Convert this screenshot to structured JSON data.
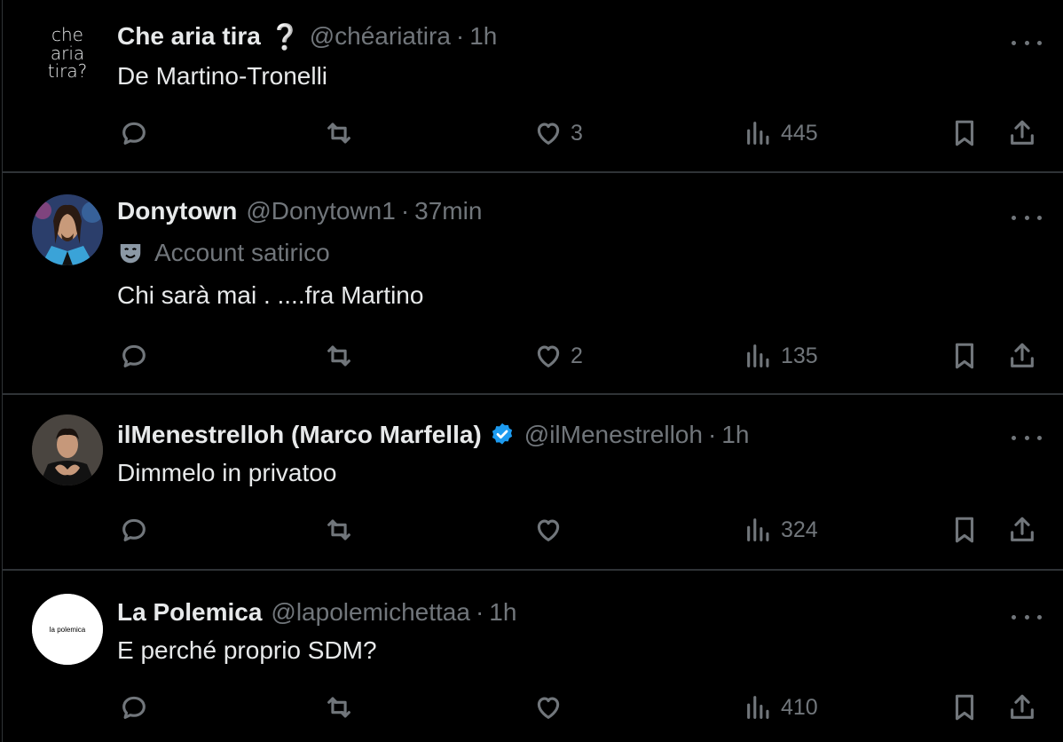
{
  "tweets": [
    {
      "name": "Che aria tira",
      "name_suffix": "❔",
      "handle": "@chéariatira",
      "dot": "·",
      "time": "1h",
      "text": "De Martino-Tronelli",
      "avatar_text": "che aria tira?",
      "replies": "",
      "retweets": "",
      "likes": "3",
      "views": "445",
      "verified": false
    },
    {
      "name": "Donytown",
      "handle": "@Donytown1",
      "dot": "·",
      "time": "37min",
      "label": "Account satirico",
      "text": "Chi sarà mai . ....fra Martino",
      "replies": "",
      "retweets": "",
      "likes": "2",
      "views": "135",
      "verified": false
    },
    {
      "name": "ilMenestrelloh (Marco Marfella)",
      "handle": "@ilMenestrelloh",
      "dot": "·",
      "time": "1h",
      "text": "Dimmelo in privatoo",
      "replies": "",
      "retweets": "",
      "likes": "",
      "views": "324",
      "verified": true
    },
    {
      "name": "La Polemica",
      "handle": "@lapolemichettaa",
      "dot": "·",
      "time": "1h",
      "text": "E perché proprio SDM?",
      "avatar_text": "la polemica",
      "replies": "",
      "retweets": "",
      "likes": "",
      "views": "410",
      "verified": false
    }
  ],
  "colors": {
    "background": "#000000",
    "text": "#e7e9ea",
    "muted": "#71767b",
    "verified": "#1d9bf0",
    "border": "#2f3336"
  }
}
